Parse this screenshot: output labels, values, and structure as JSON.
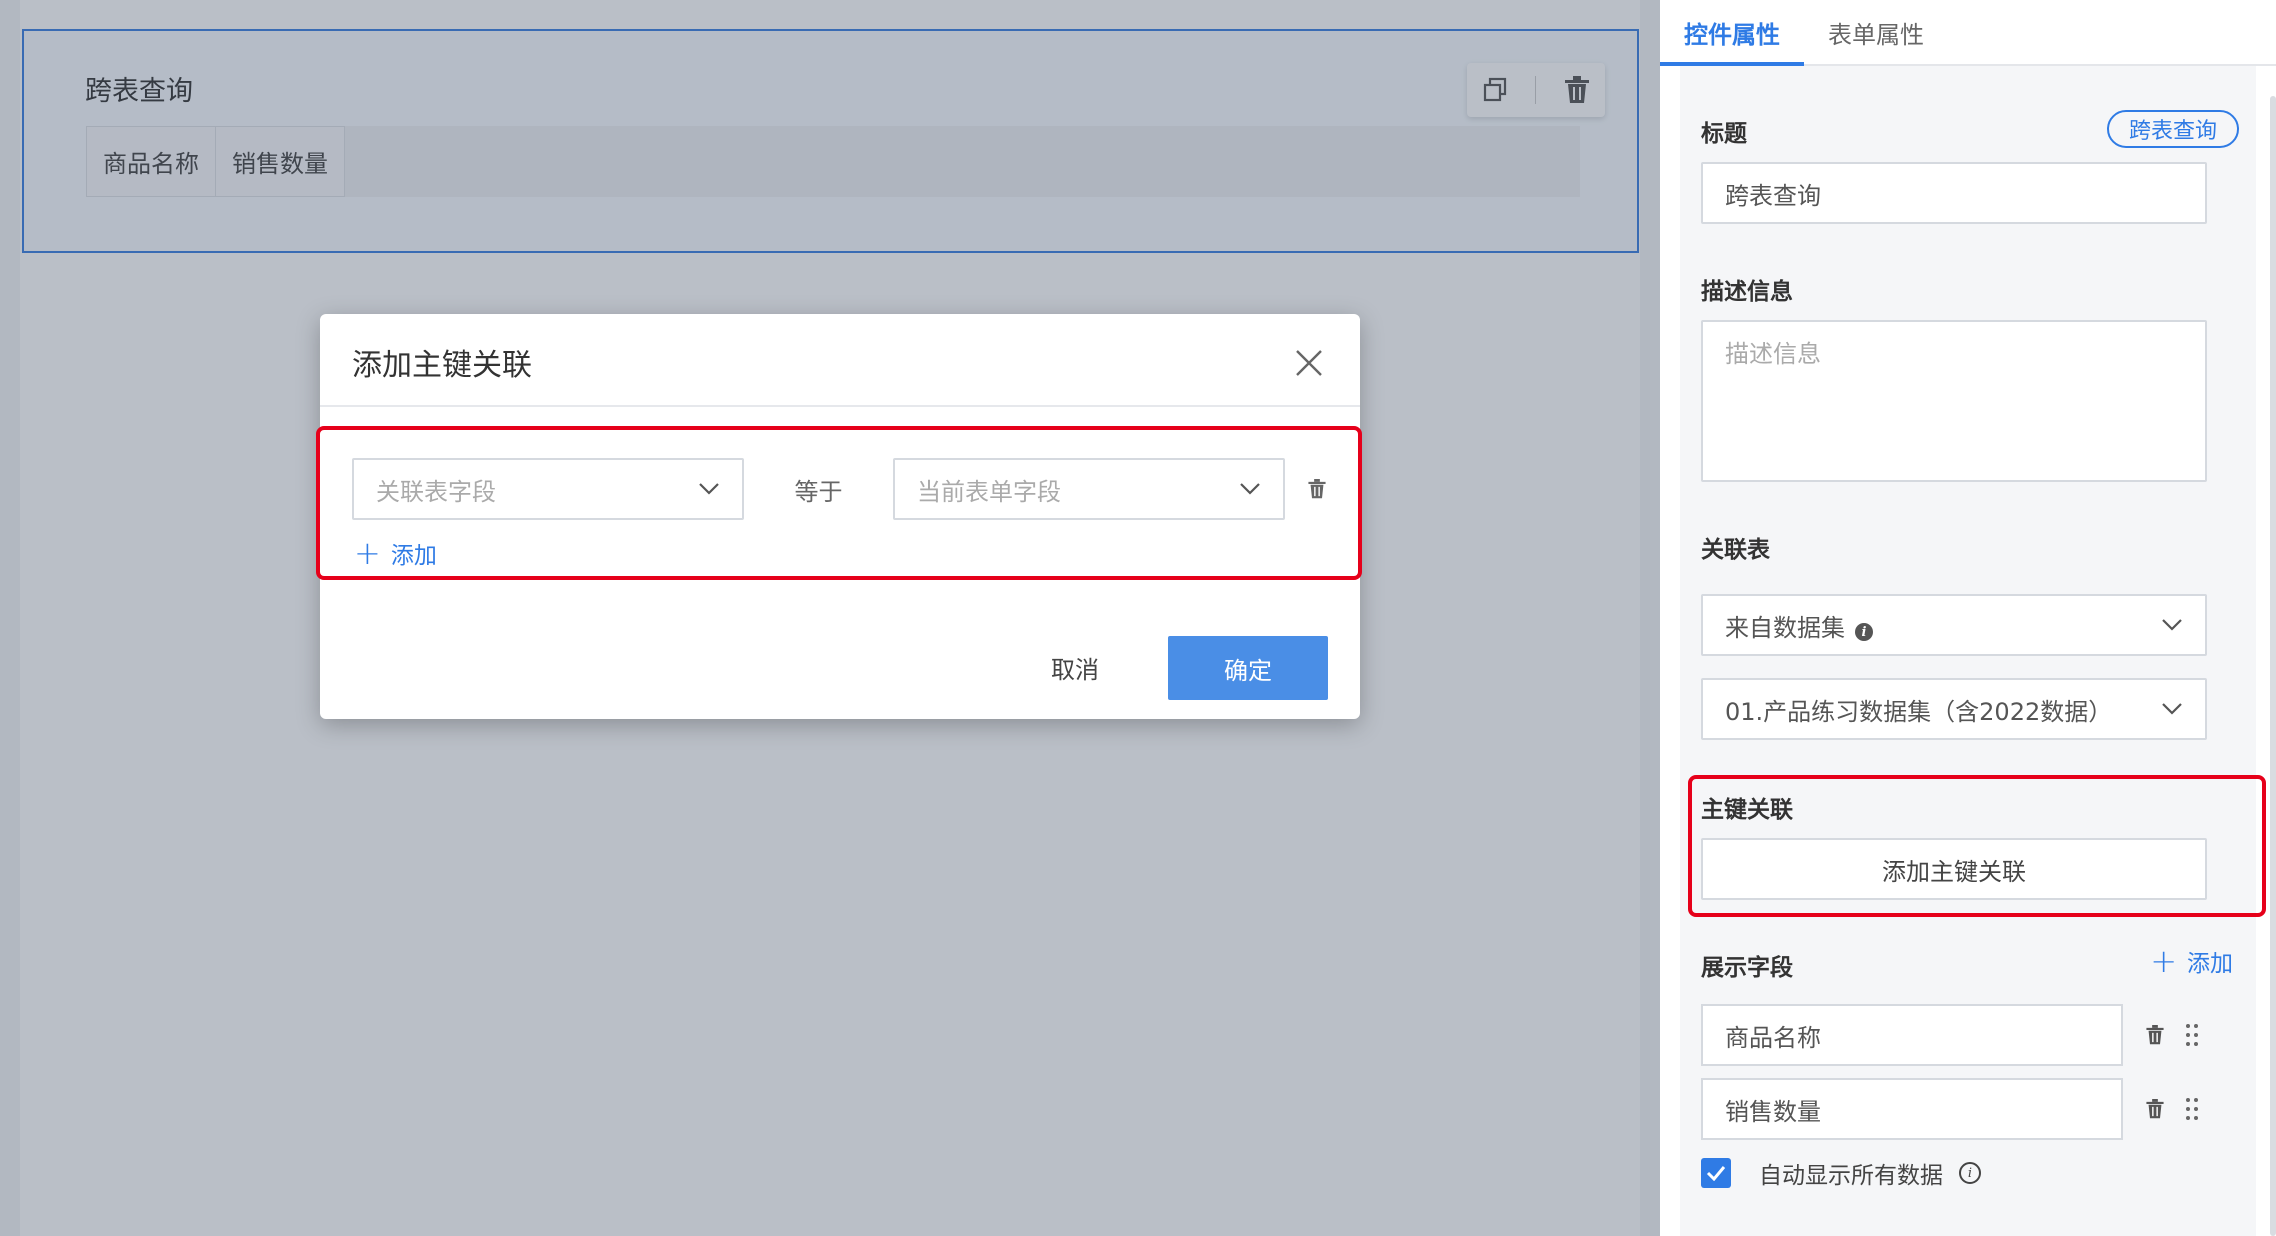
{
  "canvas": {
    "widget_title": "跨表查询",
    "columns": [
      "商品名称",
      "销售数量"
    ],
    "toolbar": {
      "copy_icon": "copy-icon",
      "delete_icon": "trash-icon"
    }
  },
  "panel": {
    "tabs": [
      {
        "label": "控件属性",
        "active": true
      },
      {
        "label": "表单属性",
        "active": false
      }
    ],
    "title_label": "标题",
    "title_tag": "跨表查询",
    "title_value": "跨表查询",
    "desc_label": "描述信息",
    "desc_placeholder": "描述信息",
    "rel_label": "关联表",
    "rel_source": "来自数据集",
    "rel_dataset": "01.产品练习数据集（含2022数据）",
    "pk_label": "主键关联",
    "pk_button": "添加主键关联",
    "display_label": "展示字段",
    "display_add": "添加",
    "fields": [
      "商品名称",
      "销售数量"
    ],
    "auto_show_label": "自动显示所有数据",
    "auto_show_checked": true
  },
  "dialog": {
    "title": "添加主键关联",
    "left_placeholder": "关联表字段",
    "equals": "等于",
    "right_placeholder": "当前表单字段",
    "add": "添加",
    "cancel": "取消",
    "ok": "确定"
  },
  "colors": {
    "accent": "#2f7be5",
    "primary_button": "#4a8ee6",
    "highlight": "#e6001a"
  }
}
